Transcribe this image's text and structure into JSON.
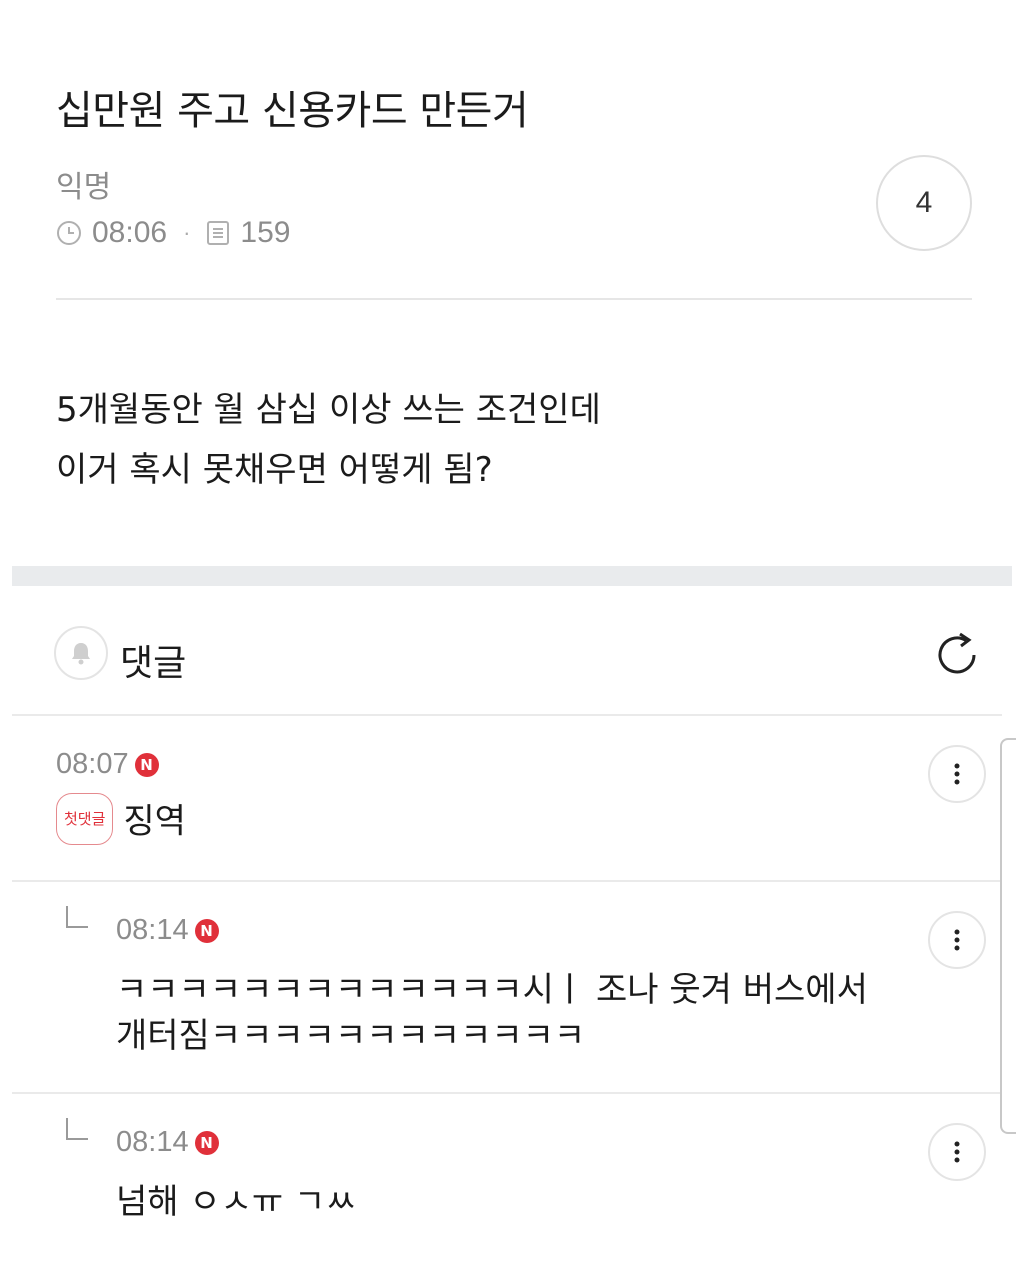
{
  "post": {
    "title": "십만원 주고 신용카드 만든거",
    "author": "익명",
    "time": "08:06",
    "views": "159",
    "comment_count": "4",
    "body_lines": [
      "5개월동안 월 삼십 이상 쓰는 조건인데",
      "이거 혹시 못채우면 어떻게 됨?"
    ]
  },
  "comments_section": {
    "label": "댓글"
  },
  "comments": [
    {
      "time": "08:07",
      "new_badge": "N",
      "first_comment_badge": "첫댓글",
      "text": "징역",
      "is_reply": false
    },
    {
      "time": "08:14",
      "new_badge": "N",
      "text_lines": [
        "ㅋㅋㅋㅋㅋㅋㅋㅋㅋㅋㅋㅋㅋ시ㅣ 조나 웃겨 버스에서",
        "개터짐ㅋㅋㅋㅋㅋㅋㅋㅋㅋㅋㅋㅋ"
      ],
      "is_reply": true
    },
    {
      "time": "08:14",
      "new_badge": "N",
      "text": "넘해 ㅇㅅㅠ ㄱㅆ",
      "is_reply": true
    }
  ],
  "colors": {
    "new_badge": "#e0303a",
    "muted_text": "#8c8c8c",
    "section_band": "#e9ebed"
  },
  "icons": [
    "clock-icon",
    "document-icon",
    "bell-icon",
    "refresh-icon",
    "more-vertical-icon",
    "reply-arrow-icon"
  ]
}
